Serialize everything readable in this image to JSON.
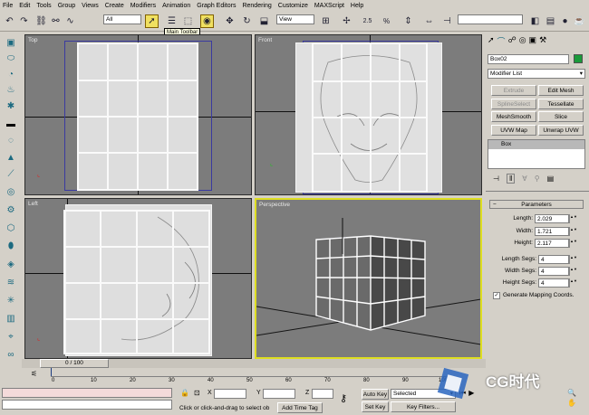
{
  "menu": [
    "File",
    "Edit",
    "Tools",
    "Group",
    "Views",
    "Create",
    "Modifiers",
    "Animation",
    "Graph Editors",
    "Rendering",
    "Customize",
    "MAXScript",
    "Help"
  ],
  "toolbar": {
    "selection_filter": "All",
    "ref_coord": "View",
    "snap_angle": "2.5",
    "snap_percent": "%",
    "tooltip": "Main Toolbar"
  },
  "viewports": {
    "top": "Top",
    "front": "Front",
    "left": "Left",
    "perspective": "Perspective"
  },
  "command_panel": {
    "object_name": "Box02",
    "object_color": "#1a9a3a",
    "modifier_list": "Modifier List",
    "buttons": [
      "Extrude",
      "Edit Mesh",
      "SplineSelect",
      "Tessellate",
      "MeshSmooth",
      "Slice",
      "UVW Map",
      "Unwrap UVW"
    ],
    "disabled_buttons": [
      "Extrude",
      "SplineSelect"
    ],
    "stack_item": "Box",
    "rollout_title": "Parameters",
    "params": [
      {
        "label": "Length:",
        "value": "2.029"
      },
      {
        "label": "Width:",
        "value": "1.721"
      },
      {
        "label": "Height:",
        "value": "2.117"
      },
      {
        "label": "Length Segs:",
        "value": "4"
      },
      {
        "label": "Width Segs:",
        "value": "4"
      },
      {
        "label": "Height Segs:",
        "value": "4"
      }
    ],
    "gen_mapping": "Generate Mapping Coords."
  },
  "timeline": {
    "frame_display": "0 / 100",
    "ticks": [
      "0",
      "10",
      "20",
      "30",
      "40",
      "50",
      "60",
      "70",
      "80",
      "90",
      "100"
    ]
  },
  "status": {
    "prompt": "Click or click-and-drag to select ob",
    "x_label": "X",
    "y_label": "Y",
    "z_label": "Z",
    "add_time_tag": "Add Time Tag",
    "auto_key": "Auto Key",
    "set_key": "Set Key",
    "selected": "Selected",
    "key_filters": "Key Filters..."
  },
  "watermark": "CG时代"
}
